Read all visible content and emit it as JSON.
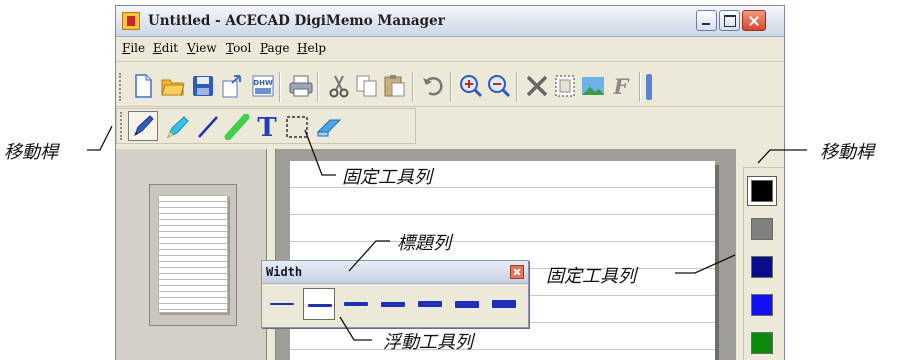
{
  "window": {
    "title": "Untitled - ACECAD DigiMemo Manager"
  },
  "menubar": {
    "items": [
      "File",
      "Edit",
      "View",
      "Tool",
      "Page",
      "Help"
    ]
  },
  "toolbar_main": {
    "icons": [
      "new-file-icon",
      "open-folder-icon",
      "save-icon",
      "export-icon",
      "dhw-icon",
      "print-icon",
      "cut-icon",
      "copy-icon",
      "paste-icon",
      "undo-icon",
      "zoom-in-icon",
      "zoom-out-icon",
      "delete-icon",
      "select-page-icon",
      "image-icon",
      "font-icon"
    ]
  },
  "toolbar_tools": {
    "icons": [
      "pen-icon",
      "highlighter-icon",
      "line-icon",
      "marker-icon",
      "text-icon",
      "selection-icon",
      "eraser-icon"
    ]
  },
  "floating_toolbar": {
    "title": "Width",
    "widths": [
      2,
      3,
      4,
      5,
      6,
      7,
      8
    ],
    "selected_index": 1
  },
  "color_palette": {
    "colors": [
      "#000000",
      "#808080",
      "#0a0a8c",
      "#1010f0",
      "#0a8a0a"
    ],
    "selected_index": 0
  },
  "annotations": {
    "left_grip": "移動桿",
    "right_grip": "移動桿",
    "fixed_toolbar_top": "固定工具列",
    "title_bar": "標題列",
    "fixed_toolbar_right": "固定工具列",
    "floating_toolbar": "浮動工具列"
  },
  "colors": {
    "titlebar": "#cdd6e6",
    "accent": "#1f2fb8",
    "window_bg": "#ece9d8"
  }
}
